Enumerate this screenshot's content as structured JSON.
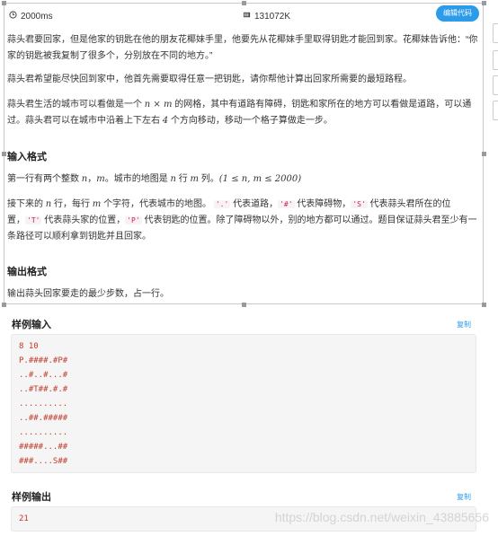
{
  "meta": {
    "time_limit": "2000ms",
    "memory_limit": "131072K",
    "edit_button": "编辑代码"
  },
  "description": {
    "p1": "蒜头君要回家，但是他家的钥匙在他的朋友花椰妹手里，他要先从花椰妹手里取得钥匙才能回到家。花椰妹告诉他：“你家的钥匙被我复制了很多个，分别放在不同的地方。”",
    "p2": "蒜头君希望能尽快回到家中，他首先需要取得任意一把钥匙，请你帮他计算出回家所需要的最短路程。",
    "p3a": "蒜头君生活的城市可以看做是一个",
    "p3m1": "n × m",
    "p3b": "的网格，其中有道路有障碍，钥匙和家所在的地方可以看做是道路，可以通过。蒜头君可以在城市中沿着上下左右",
    "p3m2": "4",
    "p3c": "个方向移动，移动一个格子算做走一步。"
  },
  "input_format": {
    "heading": "输入格式",
    "l1a": "第一行有两个整数",
    "l1m1": "n",
    "l1sep": "，",
    "l1m2": "m",
    "l1b": "。城市的地图是",
    "l1m3": "n",
    "l1c": "行",
    "l1m4": "m",
    "l1d": "列。",
    "l1m5": "(1 ≤ n, m ≤ 2000)",
    "l2a": "接下来的",
    "l2m1": "n",
    "l2b": "行，每行",
    "l2m2": "m",
    "l2c": "个字符，代表城市的地图。",
    "c_dot": "'.'",
    "l2d": "代表道路，",
    "c_hash": "'#'",
    "l2e": "代表障碍物，",
    "c_s": "'S'",
    "l2f": "代表蒜头君所在的位置，",
    "c_t": "'T'",
    "l2g": "代表蒜头家的位置，",
    "c_p": "'P'",
    "l2h": "代表钥匙的位置。除了障碍物以外，别的地方都可以通过。题目保证蒜头君至少有一条路径可以顺利拿到钥匙并且回家。"
  },
  "output_format": {
    "heading": "输出格式",
    "text": "输出蒜头回家要走的最少步数，占一行。"
  },
  "sample_input": {
    "title": "样例输入",
    "copy": "复制",
    "lines": [
      "8 10",
      "P.####.#P#",
      "..#..#...#",
      "..#T##.#.#",
      "..........",
      "..##.#####",
      "..........",
      "#####...##",
      "###....S##"
    ]
  },
  "sample_output": {
    "title": "样例输出",
    "copy": "复制",
    "lines": [
      "21"
    ]
  },
  "watermark": "https://blog.csdn.net/weixin_43885656"
}
